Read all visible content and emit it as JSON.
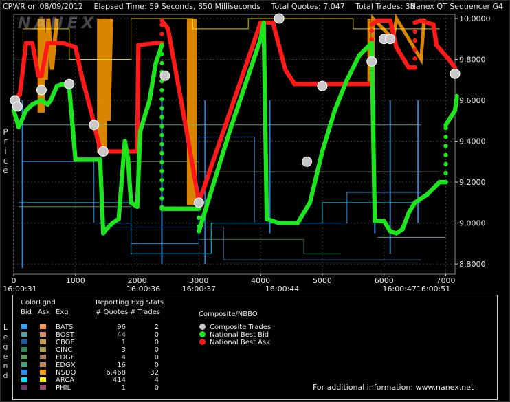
{
  "header": {
    "symbol_date": "CPWR on 08/09/2012",
    "elapsed": "Elapsed Time: 59 Seconds, 850 Milliseconds",
    "quotes": "Total Quotes: 7,047",
    "trades": "Total Trades: 38",
    "app": "Nanex QT Sequencer G4",
    "logo": "NANEX"
  },
  "y_axis_label": "Price",
  "legend_side_label": "Legend",
  "colors": {
    "bid": "#1ee61e",
    "ask": "#ff1a1a",
    "trade": "#c8c8c8",
    "nsdq": "#ff9c00",
    "arca_ask": "#ffee00",
    "bats_bid": "#3aa0ff"
  },
  "chart_data": {
    "type": "scatter",
    "x_range": [
      0,
      7150
    ],
    "y_range": [
      8.75,
      10.02
    ],
    "y_ticks": [
      "10.0000",
      "9.8000",
      "9.6000",
      "9.4000",
      "9.2000",
      "9.0000",
      "8.8000"
    ],
    "y_tick_values": [
      10.0,
      9.8,
      9.6,
      9.4,
      9.2,
      9.0,
      8.8
    ],
    "x_ticks": [
      "0",
      "1000",
      "2000",
      "3000",
      "4000",
      "5000",
      "6000",
      "7000"
    ],
    "x_tick_values": [
      0,
      1000,
      2000,
      3000,
      4000,
      5000,
      6000,
      7000
    ],
    "time_labels": [
      {
        "x": 100,
        "text": "16:00:31"
      },
      {
        "x": 2100,
        "text": "16:00:36"
      },
      {
        "x": 3000,
        "text": "16:00:37"
      },
      {
        "x": 4350,
        "text": "16:00:44"
      },
      {
        "x": 6250,
        "text": "16:00:47"
      },
      {
        "x": 6800,
        "text": "16:00:51"
      }
    ],
    "grid": true,
    "series": [
      {
        "name": "National Best Ask",
        "color": "#ff1a1a",
        "points": [
          [
            0,
            9.6
          ],
          [
            100,
            9.63
          ],
          [
            200,
            9.88
          ],
          [
            300,
            9.88
          ],
          [
            400,
            9.72
          ],
          [
            450,
            9.72
          ],
          [
            550,
            9.88
          ],
          [
            800,
            9.88
          ],
          [
            1000,
            9.86
          ],
          [
            1100,
            9.72
          ],
          [
            1250,
            9.55
          ],
          [
            1350,
            9.42
          ],
          [
            1400,
            9.36
          ],
          [
            1500,
            9.35
          ],
          [
            2000,
            9.35
          ],
          [
            2020,
            9.87
          ],
          [
            2300,
            9.88
          ],
          [
            2400,
            9.88
          ],
          [
            2400,
            9.99
          ],
          [
            2500,
            9.95
          ],
          [
            2800,
            9.45
          ],
          [
            3000,
            9.1
          ],
          [
            4000,
            9.98
          ],
          [
            4200,
            9.98
          ],
          [
            4400,
            9.75
          ],
          [
            4550,
            9.68
          ],
          [
            5000,
            9.68
          ],
          [
            5300,
            9.68
          ],
          [
            5800,
            9.68
          ],
          [
            5800,
            9.97
          ],
          [
            5900,
            9.99
          ],
          [
            6100,
            9.99
          ],
          [
            6200,
            9.86
          ],
          [
            6400,
            9.76
          ],
          [
            6500,
            9.76
          ],
          [
            6500,
            9.98
          ],
          [
            6600,
            9.99
          ],
          [
            6800,
            9.97
          ],
          [
            6850,
            9.87
          ],
          [
            7050,
            9.8
          ],
          [
            7150,
            9.76
          ]
        ]
      },
      {
        "name": "National Best Bid",
        "color": "#1ee61e",
        "points": [
          [
            0,
            9.55
          ],
          [
            80,
            9.47
          ],
          [
            200,
            9.55
          ],
          [
            300,
            9.58
          ],
          [
            450,
            9.6
          ],
          [
            550,
            9.58
          ],
          [
            600,
            9.6
          ],
          [
            700,
            9.67
          ],
          [
            800,
            9.68
          ],
          [
            900,
            9.66
          ],
          [
            1000,
            9.31
          ],
          [
            1400,
            9.31
          ],
          [
            1450,
            8.95
          ],
          [
            1500,
            8.97
          ],
          [
            1600,
            9.0
          ],
          [
            1700,
            9.02
          ],
          [
            1800,
            9.4
          ],
          [
            1850,
            9.32
          ],
          [
            1900,
            9.1
          ],
          [
            2000,
            9.08
          ],
          [
            2050,
            9.45
          ],
          [
            2200,
            9.6
          ],
          [
            2300,
            9.78
          ],
          [
            2400,
            9.87
          ],
          [
            2400,
            9.07
          ],
          [
            2600,
            9.07
          ],
          [
            3000,
            9.07
          ],
          [
            3000,
            8.96
          ],
          [
            3500,
            9.45
          ],
          [
            4000,
            9.9
          ],
          [
            4050,
            9.98
          ],
          [
            4100,
            9.02
          ],
          [
            4300,
            9.0
          ],
          [
            4600,
            9.0
          ],
          [
            4800,
            9.1
          ],
          [
            5000,
            9.35
          ],
          [
            5200,
            9.55
          ],
          [
            5400,
            9.7
          ],
          [
            5600,
            9.82
          ],
          [
            5800,
            9.88
          ],
          [
            5850,
            9.01
          ],
          [
            6000,
            9.01
          ],
          [
            6100,
            8.96
          ],
          [
            6200,
            8.95
          ],
          [
            6300,
            8.97
          ],
          [
            6400,
            9.05
          ],
          [
            6500,
            9.1
          ],
          [
            6700,
            9.14
          ],
          [
            6900,
            9.2
          ],
          [
            7000,
            9.2
          ],
          [
            7000,
            9.48
          ],
          [
            7150,
            9.55
          ],
          [
            7180,
            9.62
          ]
        ]
      },
      {
        "name": "Composite Trades",
        "color": "#c8c8c8",
        "points": [
          [
            20,
            9.6
          ],
          [
            60,
            9.57
          ],
          [
            450,
            9.65
          ],
          [
            900,
            9.68
          ],
          [
            1300,
            9.48
          ],
          [
            1450,
            9.35
          ],
          [
            2450,
            9.72
          ],
          [
            3000,
            9.1
          ],
          [
            4300,
            10.0
          ],
          [
            4750,
            9.3
          ],
          [
            5000,
            9.67
          ],
          [
            5800,
            9.79
          ],
          [
            6000,
            9.9
          ],
          [
            6100,
            9.9
          ],
          [
            7150,
            9.73
          ]
        ]
      }
    ]
  },
  "legend": {
    "color_legend": "ColorLgnd",
    "col_bid": "Bid",
    "col_ask": "Ask",
    "col_exg": "Exg",
    "stats_title": "Reporting Exg Stats",
    "col_quotes": "# Quotes",
    "col_trades": "# Trades",
    "composite_title": "Composite/NBBO",
    "exchanges": [
      {
        "name": "BATS",
        "quotes": "96",
        "trades": "2",
        "bid_color": "#3aa0ff",
        "ask_color": "#ff9c50"
      },
      {
        "name": "BOST",
        "quotes": "44",
        "trades": "0",
        "bid_color": "#5f9ea0",
        "ask_color": "#d88c6a"
      },
      {
        "name": "CBOE",
        "quotes": "1",
        "trades": "0",
        "bid_color": "#1e5aa0",
        "ask_color": "#c8964a"
      },
      {
        "name": "CINC",
        "quotes": "3",
        "trades": "0",
        "bid_color": "#2e8b57",
        "ask_color": "#b0a050"
      },
      {
        "name": "EDGE",
        "quotes": "4",
        "trades": "0",
        "bid_color": "#5aa05a",
        "ask_color": "#b07860"
      },
      {
        "name": "EDGX",
        "quotes": "16",
        "trades": "0",
        "bid_color": "#4aa07a",
        "ask_color": "#c08a60"
      },
      {
        "name": "NSDQ",
        "quotes": "6,468",
        "trades": "32",
        "bid_color": "#1e90ff",
        "ask_color": "#ff9c00"
      },
      {
        "name": "ARCA",
        "quotes": "414",
        "trades": "4",
        "bid_color": "#00e5ff",
        "ask_color": "#ffee00"
      },
      {
        "name": "PHIL",
        "quotes": "1",
        "trades": "0",
        "bid_color": "#6a3a6a",
        "ask_color": "#9a4a6a"
      }
    ],
    "composite": [
      {
        "label": "Composite Trades",
        "color": "#c8c8c8"
      },
      {
        "label": "National Best Bid",
        "color": "#1ee61e"
      },
      {
        "label": "National Best Ask",
        "color": "#ff1a1a"
      }
    ],
    "info": "For additional information: www.nanex.net"
  }
}
